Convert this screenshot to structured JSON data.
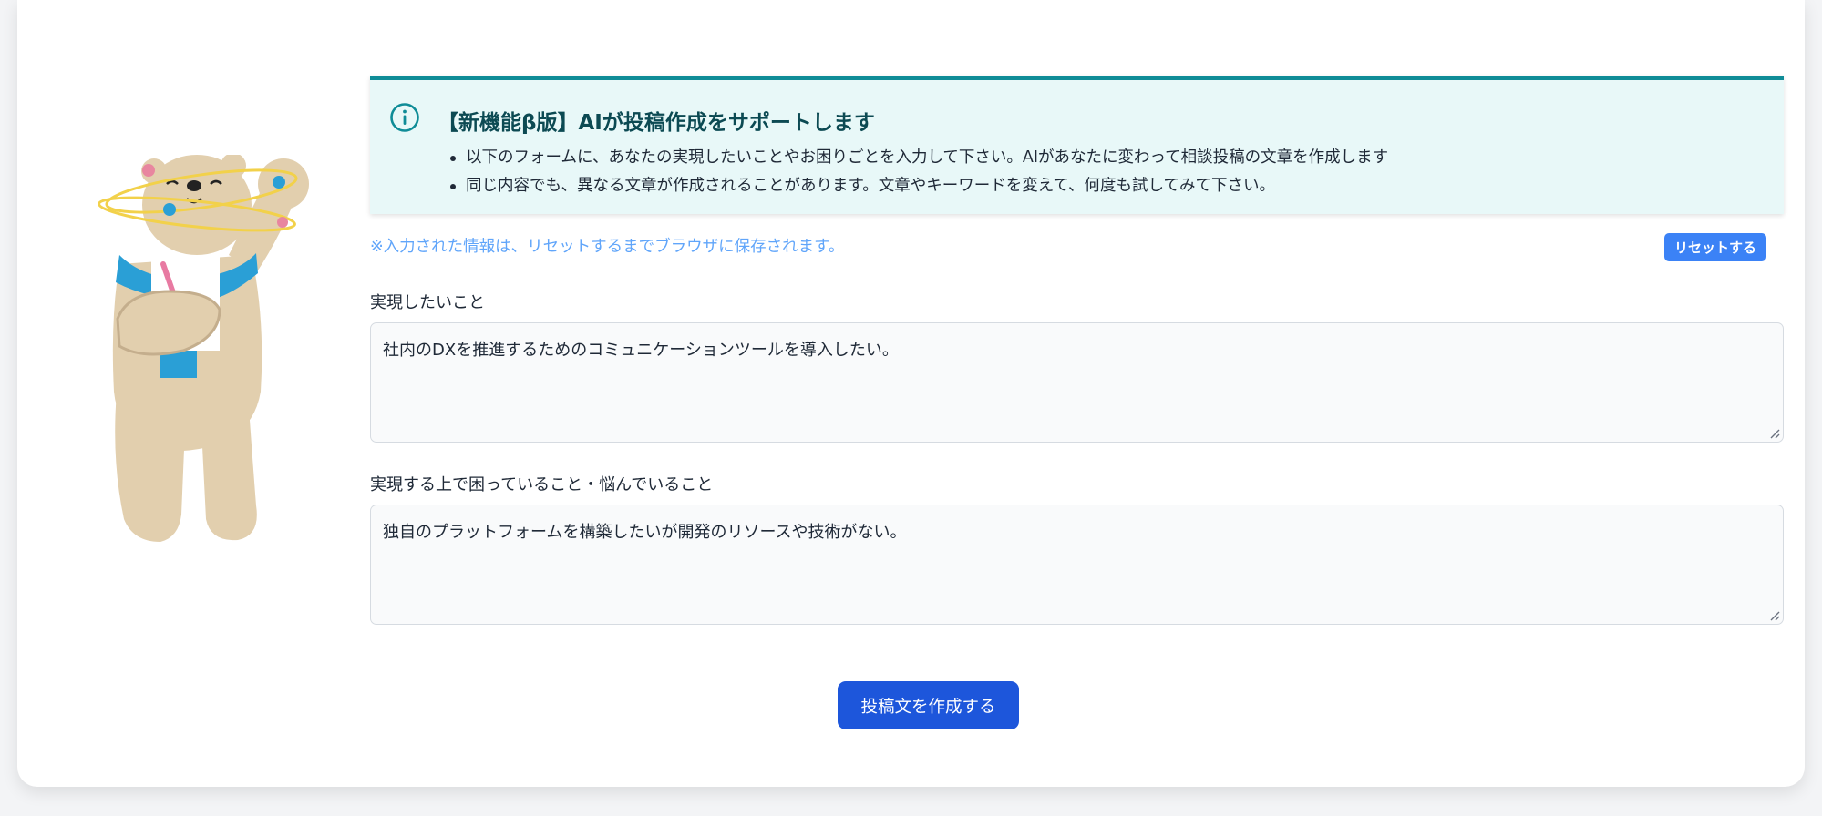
{
  "notice": {
    "icon": "info-icon",
    "accent_color": "#0f8c97",
    "title": "【新機能β版】AIが投稿作成をサポートします",
    "bullets": [
      "以下のフォームに、あなたの実現したいことやお困りごとを入力して下さい。AIがあなたに変わって相談投稿の文章を作成します",
      "同じ内容でも、異なる文章が作成されることがあります。文章やキーワードを変えて、何度も試してみて下さい。"
    ]
  },
  "storage_note": "※入力された情報は、リセットするまでブラウザに保存されます。",
  "reset_label": "リセットする",
  "fields": [
    {
      "label": "実現したいこと",
      "value": "社内のDXを推進するためのコミュニケーションツールを導入したい。"
    },
    {
      "label": "実現する上で困っていること・悩んでいること",
      "value": "独自のプラットフォームを構築したいが開発のリソースや技術がない。"
    }
  ],
  "submit_label": "投稿文を作成する",
  "colors": {
    "primary": "#1d56db",
    "reset": "#3b82f6",
    "note": "#60a5fa"
  }
}
